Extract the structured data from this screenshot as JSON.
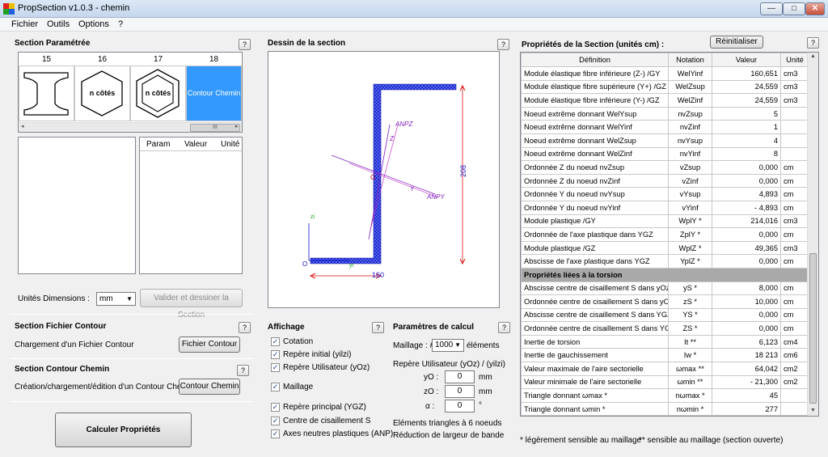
{
  "window": {
    "title": "PropSection v1.0.3 - chemin",
    "min": "—",
    "max": "□",
    "close": "✕"
  },
  "menu": [
    "Fichier",
    "Outils",
    "Options",
    "?"
  ],
  "section_param": {
    "title": "Section Paramétrée",
    "help": "?",
    "columns": [
      "15",
      "16",
      "17",
      "18"
    ],
    "cells": [
      "",
      "n côtés",
      "n côtés",
      "Contour Chemin"
    ],
    "scroll_thumb": "III",
    "scroll_left": "◂",
    "scroll_right": "▸",
    "param_headers": [
      "Param",
      "Valeur",
      "Unité"
    ],
    "units_label": "Unités Dimensions :",
    "units_value": "mm",
    "validate_button": "Valider et dessiner la Section"
  },
  "fichier_contour": {
    "title": "Section Fichier Contour",
    "help": "?",
    "desc": "Chargement d'un Fichier Contour",
    "button": "Fichier Contour"
  },
  "contour_chemin": {
    "title": "Section Contour Chemin",
    "help": "?",
    "desc": "Création/chargement/édition d'un Contour Chemin",
    "button": "Contour Chemin"
  },
  "calc_button": "Calculer Propriétés",
  "drawing": {
    "title": "Dessin de la section",
    "help": "?",
    "dim_height": "208",
    "dim_width": "160",
    "labels": {
      "anpz": "ANPZ",
      "anpy": "ANPY",
      "z": "Z",
      "y": "Y",
      "zi": "zi",
      "yi": "yi",
      "o": "O",
      "g": "G"
    }
  },
  "affichage": {
    "title": "Affichage",
    "help": "?",
    "items": [
      {
        "label": "Cotation",
        "checked": true
      },
      {
        "label": "Repère initial (yilzi)",
        "checked": true
      },
      {
        "label": "Repère Utilisateur (yOz)",
        "checked": true
      },
      {
        "label": "Maillage",
        "checked": true
      },
      {
        "label": "Repère principal (YGZ)",
        "checked": true
      },
      {
        "label": "Centre de cisaillement S",
        "checked": true
      },
      {
        "label": "Axes neutres plastiques (ANP)",
        "checked": true
      }
    ],
    "check_mark": "✓"
  },
  "calcul": {
    "title": "Paramètres de calcul",
    "help": "?",
    "maillage_label": "Maillage : #",
    "maillage_value": "1000",
    "maillage_unit": "éléments",
    "repere_label": "Repère Utilisateur (yOz)  /  (yilzi)",
    "yo_label": "yO :",
    "yo_value": "0",
    "yo_unit": "mm",
    "zo_label": "zO :",
    "zo_value": "0",
    "zo_unit": "mm",
    "alpha_label": "α :",
    "alpha_value": "0",
    "alpha_unit": "°",
    "note1": "Eléments triangles à 6 noeuds",
    "note2": "Réduction de largeur de bande"
  },
  "props": {
    "title": "Propriétés de la Section (unités cm) :",
    "reset_button": "Réinitialiser",
    "help": "?",
    "headers": [
      "Définition",
      "Notation",
      "Valeur",
      "Unité"
    ],
    "rows": [
      {
        "def": "Module élastique fibre inférieure (Z-) /GY",
        "not": "WelYinf",
        "val": "160,651",
        "unit": "cm3"
      },
      {
        "def": "Module élastique fibre supérieure (Y+) /GZ",
        "not": "WelZsup",
        "val": "24,559",
        "unit": "cm3"
      },
      {
        "def": "Module élastique fibre inférieure (Y-) /GZ",
        "not": "WelZinf",
        "val": "24,559",
        "unit": "cm3"
      },
      {
        "def": "Noeud extrême donnant WelYsup",
        "not": "nvZsup",
        "val": "5",
        "unit": ""
      },
      {
        "def": "Noeud extrême donnant WelYinf",
        "not": "nvZinf",
        "val": "1",
        "unit": ""
      },
      {
        "def": "Noeud extrême donnant WelZsup",
        "not": "nvYsup",
        "val": "4",
        "unit": ""
      },
      {
        "def": "Noeud extrême donnant WelZinf",
        "not": "nvYinf",
        "val": "8",
        "unit": ""
      },
      {
        "def": "Ordonnée Z du noeud nvZsup",
        "not": "vZsup",
        "val": "0,000",
        "unit": "cm"
      },
      {
        "def": "Ordonnée Z du noeud nvZinf",
        "not": "vZinf",
        "val": "0,000",
        "unit": "cm"
      },
      {
        "def": "Ordonnée Y du noeud nvYsup",
        "not": "vYsup",
        "val": "4,893",
        "unit": "cm"
      },
      {
        "def": "Ordonnée Y du noeud nvYinf",
        "not": "vYinf",
        "val": "-  4,893",
        "unit": "cm"
      },
      {
        "def": "Module plastique /GY",
        "not": "WplY *",
        "val": "214,016",
        "unit": "cm3"
      },
      {
        "def": "Ordonnée de l'axe plastique dans YGZ",
        "not": "ZplY *",
        "val": "0,000",
        "unit": "cm"
      },
      {
        "def": "Module plastique /GZ",
        "not": "WplZ *",
        "val": "49,365",
        "unit": "cm3"
      },
      {
        "def": "Abscisse de l'axe plastique dans YGZ",
        "not": "YplZ *",
        "val": "0,000",
        "unit": "cm"
      },
      {
        "group": "Propriétés liées à la torsion"
      },
      {
        "def": "Abscisse centre de cisaillement S dans yOz",
        "not": "yS *",
        "val": "8,000",
        "unit": "cm"
      },
      {
        "def": "Ordonnée centre de cisaillement S dans yOz",
        "not": "zS *",
        "val": "10,000",
        "unit": "cm"
      },
      {
        "def": "Abscisse centre de cisaillement S dans YGZ",
        "not": "YS *",
        "val": "0,000",
        "unit": "cm"
      },
      {
        "def": "Ordonnée centre de cisaillement S dans YGZ",
        "not": "ZS *",
        "val": "0,000",
        "unit": "cm"
      },
      {
        "def": "Inertie de torsion",
        "not": "It **",
        "val": "6,123",
        "unit": "cm4"
      },
      {
        "def": "Inertie de gauchissement",
        "not": "Iw *",
        "val": "18 213",
        "unit": "cm6"
      },
      {
        "def": "Valeur maximale de l'aire sectorielle",
        "not": "ωmax **",
        "val": "64,042",
        "unit": "cm2"
      },
      {
        "def": "Valeur minimale de l'aire sectorielle",
        "not": "ωmin **",
        "val": "-  21,300",
        "unit": "cm2"
      },
      {
        "def": "Triangle donnant ωmax *",
        "not": "nωmax *",
        "val": "45",
        "unit": ""
      },
      {
        "def": "Triangle donnant ωmin *",
        "not": "nωmin *",
        "val": "277",
        "unit": ""
      }
    ],
    "footnote1": "* légèrement sensible au maillage",
    "footnote2": "** sensible au maillage (section ouverte)"
  }
}
